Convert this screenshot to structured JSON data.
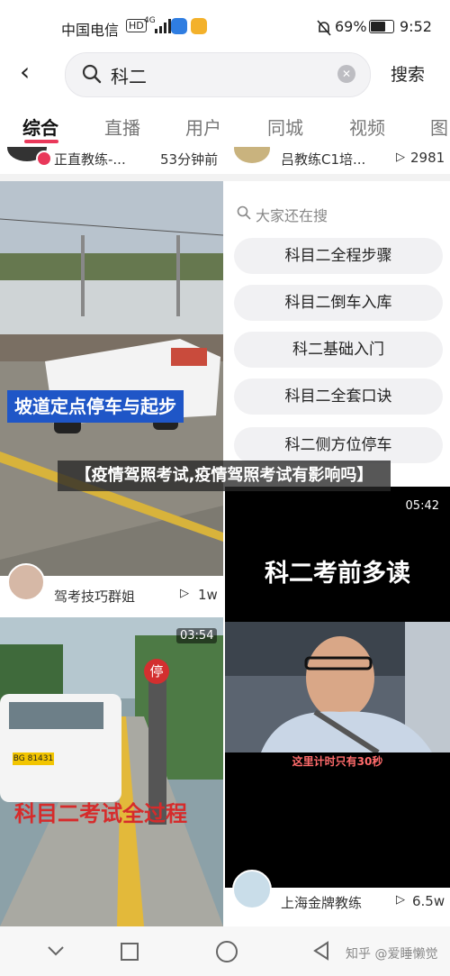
{
  "status_bar": {
    "carrier": "中国电信",
    "hd": "HD",
    "network": "4G",
    "battery": "69%",
    "time": "9:52"
  },
  "search": {
    "query": "科二",
    "submit_label": "搜索"
  },
  "tabs": [
    {
      "label": "综合",
      "active": true
    },
    {
      "label": "直播"
    },
    {
      "label": "用户"
    },
    {
      "label": "同城"
    },
    {
      "label": "视频"
    },
    {
      "label": "图"
    }
  ],
  "top_partial": {
    "left_author": "正直教练-...",
    "left_time": "53分钟前",
    "right_author": "吕教练C1培...",
    "right_plays": "2981"
  },
  "card1": {
    "caption": "坡道定点停车与起步",
    "author": "驾考技巧群姐",
    "plays": "1w"
  },
  "related_search": {
    "title": "大家还在搜",
    "items": [
      "科目二全程步骤",
      "科目二倒车入库",
      "科二基础入门",
      "科目二全套口诀",
      "科二侧方位停车"
    ]
  },
  "overlay": {
    "title": "【疫情驾照考试,疫情驾照考试有影响吗】"
  },
  "card3": {
    "duration": "05:42",
    "headline": "科二考前多读",
    "subtitle": "这里计时只有30秒",
    "author": "上海金牌教练",
    "plays": "6.5w"
  },
  "card4": {
    "duration": "03:54",
    "caption": "科目二考试全过程",
    "sign": "停",
    "plate": "BG 81431"
  },
  "watermark": "知乎 @爱睡懒觉",
  "colors": {
    "accent": "#e9385a",
    "chip_bg": "#f1f1f3"
  }
}
